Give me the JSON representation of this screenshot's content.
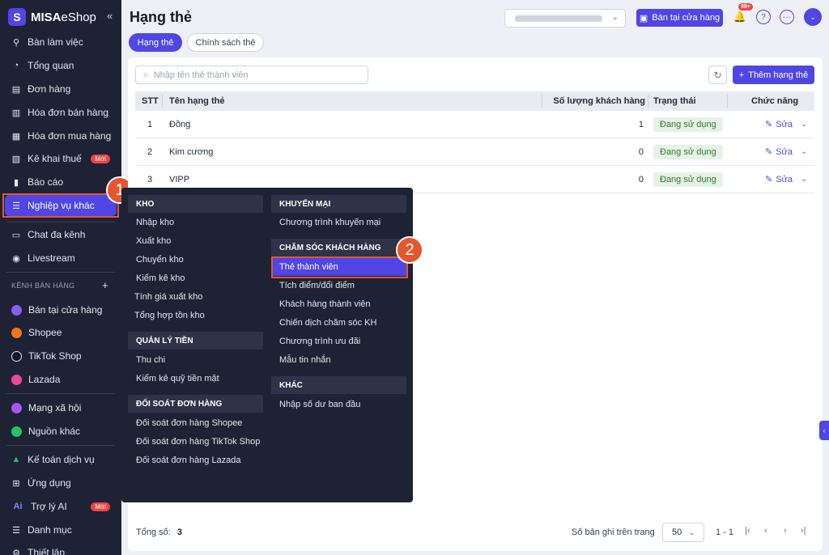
{
  "sidebar": {
    "logo_main": "MISA",
    "logo_sub": "eShop",
    "collapse": "«",
    "items": [
      {
        "label": "Bàn làm việc",
        "icon": "pin-icon",
        "glyph": "⚲"
      },
      {
        "label": "Tổng quan",
        "icon": "compass-icon",
        "glyph": "◔"
      },
      {
        "label": "Đơn hàng",
        "icon": "order-icon",
        "glyph": "▤"
      },
      {
        "label": "Hóa đơn bán hàng",
        "icon": "invoice-icon",
        "glyph": "▥"
      },
      {
        "label": "Hóa đơn mua hàng",
        "icon": "receipt-icon",
        "glyph": "▦"
      },
      {
        "label": "Kê khai thuế",
        "icon": "tax-icon",
        "glyph": "▧"
      },
      {
        "label": "Báo cáo",
        "icon": "report-icon",
        "glyph": "▮"
      },
      {
        "label": "Nghiệp vụ khác",
        "icon": "list-icon",
        "glyph": "☰"
      },
      {
        "label": "Chat đa kênh",
        "icon": "chat-icon",
        "glyph": "▭"
      },
      {
        "label": "Livestream",
        "icon": "livestream-icon",
        "glyph": "◉"
      }
    ],
    "new_badge": "Mới",
    "channel_section": "KÊNH BÁN HÀNG",
    "channel_add": "+",
    "channels": [
      {
        "label": "Bán tại cửa hàng",
        "color": "#8b5cf6"
      },
      {
        "label": "Shopee",
        "color": "#f97316"
      },
      {
        "label": "TikTok Shop",
        "color": "#111827"
      },
      {
        "label": "Lazada",
        "color": "#ec4899"
      }
    ],
    "bottom_items": [
      {
        "label": "Mạng xã hội",
        "color": "#a855f7"
      },
      {
        "label": "Nguồn khác",
        "color": "#22c55e"
      },
      {
        "label": "Kế toán dịch vụ",
        "glyph": "▲"
      },
      {
        "label": "Ứng dụng",
        "glyph": "⊞"
      },
      {
        "label": "Trợ lý AI",
        "glyph": "Ai"
      },
      {
        "label": "Danh mục",
        "glyph": "☰"
      },
      {
        "label": "Thiết lập",
        "glyph": "⚙"
      }
    ]
  },
  "header": {
    "title": "Hạng thẻ",
    "store_button": "Bán tại cửa hàng",
    "notif_count": "99+",
    "help_icon": "?",
    "more_icon": "···",
    "bell_icon": "🔔",
    "chevron": "⌄"
  },
  "tabs": [
    "Hạng thẻ",
    "Chính sách thẻ"
  ],
  "toolbar": {
    "search_placeholder": "Nhập tên thẻ thành viên",
    "add_button": "Thêm hạng thẻ",
    "refresh_icon": "↻",
    "search_icon": "⌕",
    "plus": "+"
  },
  "table": {
    "columns": [
      "STT",
      "Tên hạng thẻ",
      "Số lượng khách hàng",
      "Trạng thái",
      "Chức năng"
    ],
    "rows": [
      {
        "stt": "1",
        "name": "Đồng",
        "count": "1",
        "status": "Đang sử dụng",
        "action": "Sửa"
      },
      {
        "stt": "2",
        "name": "Kim cương",
        "count": "0",
        "status": "Đang sử dụng",
        "action": "Sửa"
      },
      {
        "stt": "3",
        "name": "VIPP",
        "count": "0",
        "status": "Đang sử dụng",
        "action": "Sửa"
      }
    ],
    "edit_icon": "✎",
    "drop_icon": "⌄"
  },
  "menu": {
    "left": [
      {
        "heading": "KHO",
        "items": [
          "Nhập kho",
          "Xuất kho",
          "Chuyển kho",
          "Kiểm kê kho",
          "Tính giá xuất kho",
          "Tổng hợp tồn kho"
        ]
      },
      {
        "heading": "QUẢN LÝ TIỀN",
        "items": [
          "Thu chi",
          "Kiểm kê quỹ tiền mặt"
        ]
      },
      {
        "heading": "ĐỐI SOÁT ĐƠN HÀNG",
        "items": [
          "Đối soát đơn hàng Shopee",
          "Đối soát đơn hàng TikTok Shop",
          "Đối soát đơn hàng Lazada"
        ]
      }
    ],
    "right": [
      {
        "heading": "KHUYẾN MẠI",
        "items": [
          "Chương trình khuyến mại"
        ]
      },
      {
        "heading": "CHĂM SÓC KHÁCH HÀNG",
        "items": [
          "Thẻ thành viên",
          "Tích điểm/đổi điểm",
          "Khách hàng thành viên",
          "Chiến dịch chăm sóc KH",
          "Chương trình ưu đãi",
          "Mẫu tin nhắn"
        ]
      },
      {
        "heading": "KHÁC",
        "items": [
          "Nhập số dư ban đầu"
        ]
      }
    ]
  },
  "steps": [
    "1",
    "2"
  ],
  "footer": {
    "total_label": "Tổng số:",
    "total_value": "3",
    "per_page_label": "Số bản ghi trên trang",
    "page_size": "50",
    "range": "1 - 1",
    "first": "|‹",
    "prev": "‹",
    "next": "›",
    "last": "›|"
  },
  "side_tab": "‹",
  "colors": {
    "accent": "#4f46e5",
    "sidebar": "#1e2235",
    "highlight": "#e4572e",
    "new_badge": "#ef4444"
  }
}
